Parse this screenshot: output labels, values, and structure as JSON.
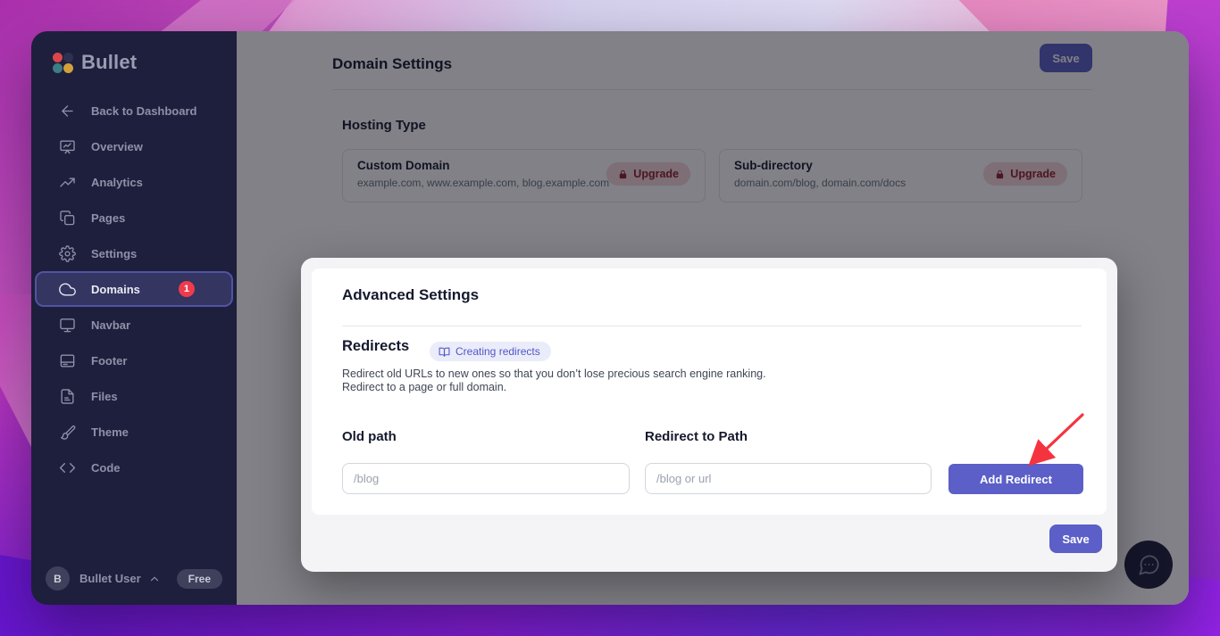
{
  "app": {
    "logo_text": "Bullet"
  },
  "sidebar": {
    "back_label": "Back to Dashboard",
    "items": [
      {
        "label": "Overview",
        "icon": "presentation-icon"
      },
      {
        "label": "Analytics",
        "icon": "trending-up-icon"
      },
      {
        "label": "Pages",
        "icon": "pages-icon"
      },
      {
        "label": "Settings",
        "icon": "gear-icon"
      },
      {
        "label": "Domains",
        "icon": "cloud-icon",
        "badge": "1",
        "active": true
      },
      {
        "label": "Navbar",
        "icon": "monitor-icon"
      },
      {
        "label": "Footer",
        "icon": "footer-icon"
      },
      {
        "label": "Files",
        "icon": "file-icon"
      },
      {
        "label": "Theme",
        "icon": "paintbrush-icon"
      },
      {
        "label": "Code",
        "icon": "code-icon"
      }
    ],
    "user": {
      "initial": "B",
      "name": "Bullet User",
      "plan": "Free"
    }
  },
  "main": {
    "title": "Domain Settings",
    "save_label": "Save",
    "hosting": {
      "heading": "Hosting Type",
      "cards": [
        {
          "title": "Custom Domain",
          "subtitle": "example.com, www.example.com, blog.example.com",
          "badge": "Upgrade"
        },
        {
          "title": "Sub-directory",
          "subtitle": "domain.com/blog, domain.com/docs",
          "badge": "Upgrade"
        }
      ]
    }
  },
  "modal": {
    "title": "Advanced Settings",
    "redirects": {
      "heading": "Redirects",
      "docs_chip": "Creating redirects",
      "description_line1": "Redirect old URLs to new ones so that you don’t lose precious search engine ranking.",
      "description_line2": "Redirect to a page or full domain.",
      "old_path_label": "Old path",
      "old_path_placeholder": "/blog",
      "redirect_to_label": "Redirect to Path",
      "redirect_to_placeholder": "/blog or url",
      "add_button_label": "Add Redirect"
    },
    "save_label": "Save"
  },
  "colors": {
    "accent": "#5b5fc7",
    "sidebar_bg": "#1e1f3c",
    "active_item_border": "#5054a4",
    "notification_red": "#ef3b4c",
    "upgrade_badge_bg": "#f8d7d9",
    "upgrade_badge_text": "#8f2030",
    "annotation_arrow": "#f5333f"
  }
}
